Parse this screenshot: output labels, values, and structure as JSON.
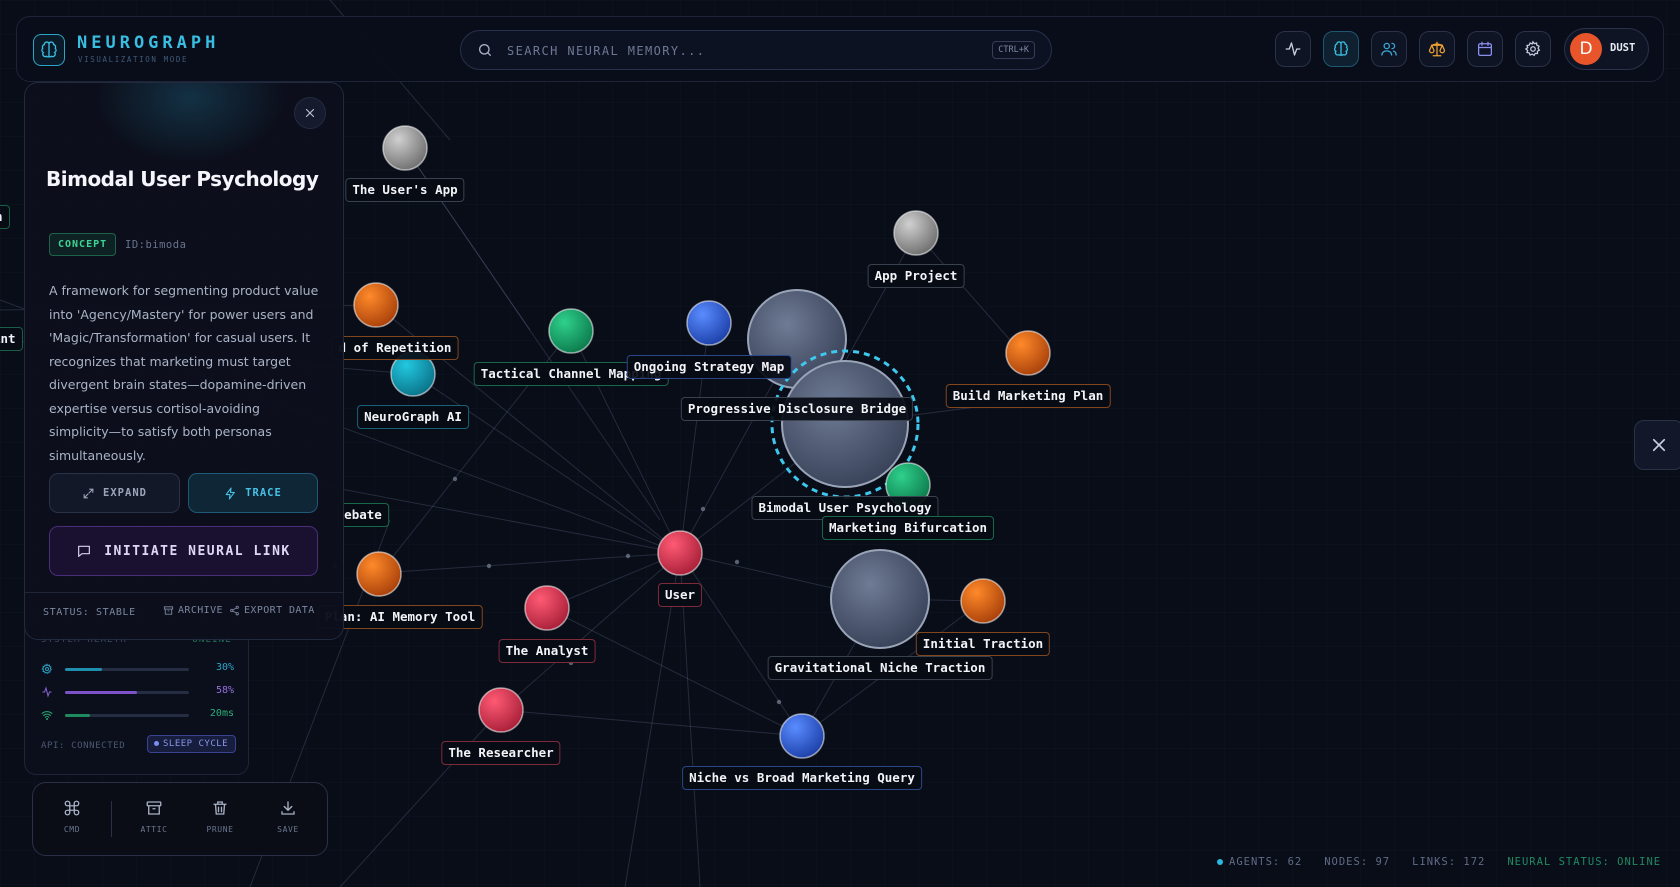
{
  "header": {
    "title": "NEUROGRAPH",
    "subtitle": "VISUALIZATION MODE",
    "search_placeholder": "SEARCH NEURAL MEMORY...",
    "shortcut": "CTRL+K",
    "buttons": [
      "activity-icon",
      "brain-icon",
      "users-icon",
      "scale-icon",
      "calendar-icon",
      "gear-icon"
    ],
    "user": {
      "initial": "D",
      "name": "DUST"
    }
  },
  "colors": {
    "accent": "#39bde0",
    "orange": "#e06a1a",
    "green": "#1fae74",
    "teal": "#15a7c2",
    "red": "#e23d5a",
    "blue": "#3b6fe0",
    "gray": "#9a9a9a",
    "slate": "#5a6680"
  },
  "graph": {
    "nodes": [
      {
        "id": "users-app",
        "label": "The User's App",
        "color": "gray"
      },
      {
        "id": "app-project",
        "label": "App Project",
        "color": "gray"
      },
      {
        "id": "repetition",
        "label": "d of Repetition",
        "color": "orange"
      },
      {
        "id": "tactical",
        "label": "Tactical Channel Mapping",
        "color": "green"
      },
      {
        "id": "strategy",
        "label": "Ongoing Strategy Map",
        "color": "blue"
      },
      {
        "id": "neurograph-ai",
        "label": "NeuroGraph AI",
        "color": "teal"
      },
      {
        "id": "progressive",
        "label": "Progressive Disclosure Bridge",
        "color": "slate"
      },
      {
        "id": "build-marketing",
        "label": "Build Marketing Plan",
        "color": "orange"
      },
      {
        "id": "bimodal",
        "label": "Bimodal User Psychology",
        "color": "slate"
      },
      {
        "id": "marketing-bif",
        "label": "Marketing Bifurcation",
        "color": "green"
      },
      {
        "id": "debate",
        "label": "ebate",
        "color": "green"
      },
      {
        "id": "user",
        "label": "User",
        "color": "red"
      },
      {
        "id": "plan-ai",
        "label": "Plan: AI Memory Tool",
        "color": "orange"
      },
      {
        "id": "analyst",
        "label": "The Analyst",
        "color": "red"
      },
      {
        "id": "gravitational",
        "label": "Gravitational Niche Traction",
        "color": "slate"
      },
      {
        "id": "initial-traction",
        "label": "Initial Traction",
        "color": "orange"
      },
      {
        "id": "researcher",
        "label": "The Researcher",
        "color": "red"
      },
      {
        "id": "niche-query",
        "label": "Niche vs Broad Marketing Query",
        "color": "blue"
      }
    ],
    "left_stubs": [
      "n",
      "int"
    ]
  },
  "detail": {
    "title": "Bimodal User Psychology",
    "type": "CONCEPT",
    "id": "ID:bimoda",
    "description": "A framework for segmenting product value into 'Agency/Mastery' for power users and 'Magic/Transformation' for casual users. It recognizes that marketing must target divergent brain states—dopamine-driven expertise versus cortisol-avoiding simplicity—to satisfy both personas simultaneously.",
    "expand_label": "EXPAND",
    "trace_label": "TRACE",
    "neural_link_label": "INITIATE NEURAL LINK",
    "status": "STATUS: STABLE",
    "archive_label": "ARCHIVE",
    "export_label": "EXPORT DATA"
  },
  "health": {
    "title": "SYSTEM HEALTH",
    "status": "ONLINE",
    "metrics": [
      {
        "name": "cpu",
        "value_text": "30%",
        "level": 0.3
      },
      {
        "name": "activity",
        "value_text": "58%",
        "level": 0.58
      },
      {
        "name": "latency",
        "value_text": "20ms",
        "level": 0.2
      }
    ],
    "api": "API: CONNECTED",
    "sleep_label": "SLEEP CYCLE"
  },
  "toolbar": {
    "cmd": "CMD",
    "attic": "ATTIC",
    "prune": "PRUNE",
    "save": "SAVE"
  },
  "statusbar": {
    "agents": "AGENTS: 62",
    "nodes": "NODES: 97",
    "links": "LINKS: 172",
    "neural": "NEURAL STATUS: ONLINE"
  }
}
